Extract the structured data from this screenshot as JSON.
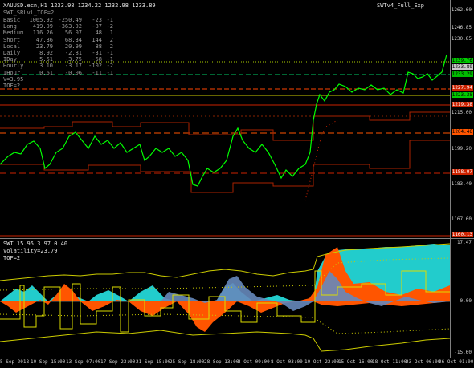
{
  "header": {
    "symbol_line": "XAUUSD.ecn,H1  1233.98 1234.22 1232.98 1233.89",
    "indicator_name": "SWT_SRLvl_TOF=2",
    "indicator_tag": "SWTv4_Full_Exp"
  },
  "stats": {
    "rows": [
      {
        "name": "Basic",
        "a": "1065.92",
        "b": "-250.49",
        "c": "-23",
        "d": "-1"
      },
      {
        "name": "Long",
        "a": "419.09",
        "b": "-363.02",
        "c": "-87",
        "d": "-2"
      },
      {
        "name": "Medium",
        "a": "116.26",
        "b": "56.07",
        "c": "48",
        "d": "1"
      },
      {
        "name": "Short",
        "a": "47.36",
        "b": "68.34",
        "c": "144",
        "d": "2"
      },
      {
        "name": "Local",
        "a": "23.79",
        "b": "20.99",
        "c": "88",
        "d": "2"
      },
      {
        "name": "Daily",
        "a": "8.92",
        "b": "-2.81",
        "c": "-31",
        "d": "-1"
      },
      {
        "name": "IDay",
        "a": "5.51",
        "b": "-3.75",
        "c": "-68",
        "d": "-1"
      },
      {
        "name": "Hourly",
        "a": "3.10",
        "b": "-3.17",
        "c": "-102",
        "d": "-2"
      },
      {
        "name": "IHour",
        "a": "0.61",
        "b": "-0.06",
        "c": "-11",
        "d": "-1"
      }
    ],
    "v_line": "V=3.95",
    "tof_line": "TOF=2"
  },
  "sub": {
    "title": "SWT 15.95 3.97 0.40",
    "volatility": "Volatility=23.79",
    "tof": "TOF=2"
  },
  "main_axis": {
    "ticks": [
      "1262.60",
      "1246.85",
      "1230.85",
      "1215.00",
      "1199.20",
      "1183.40",
      "1167.60"
    ],
    "labels": [
      {
        "text": "1239.76",
        "bg": "#00cc00",
        "fg": "#000"
      },
      {
        "text": "1233.89",
        "bg": "#c8c8c8",
        "fg": "#000"
      },
      {
        "text": "1233.29",
        "bg": "#00bb00",
        "fg": "#000"
      },
      {
        "text": "1227.94",
        "bg": "#cc2200",
        "fg": "#fff"
      },
      {
        "text": "1223.38",
        "bg": "#00cc00",
        "fg": "#000"
      },
      {
        "text": "1219.38",
        "bg": "#cc2200",
        "fg": "#fff"
      },
      {
        "text": "1204.46",
        "bg": "#ff5500",
        "fg": "#000"
      },
      {
        "text": "1188.07",
        "bg": "#cc2200",
        "fg": "#fff"
      },
      {
        "text": "1160.13",
        "bg": "#cc2200",
        "fg": "#fff"
      }
    ]
  },
  "sub_axis": {
    "ticks": [
      "17.47",
      "0.00",
      "-15.60"
    ]
  },
  "xaxis": {
    "ticks": [
      "5 Sep 2018",
      "10 Sep 15:00",
      "13 Sep 07:00",
      "17 Sep 23:00",
      "21 Sep 15:00",
      "25 Sep 18:00",
      "28 Sep 13:00",
      "3 Oct 09:00",
      "8 Oct 03:00",
      "10 Oct 22:00",
      "15 Oct 16:00",
      "18 Oct 11:00",
      "23 Oct 06:00",
      "26 Oct 01:00"
    ]
  },
  "colors": {
    "price": "#00ff00",
    "sr_red": "#cc2200",
    "sr_yellow": "#cccc00",
    "cyan": "#22cccc",
    "orange": "#ff5500",
    "steel": "#6688bb"
  }
}
